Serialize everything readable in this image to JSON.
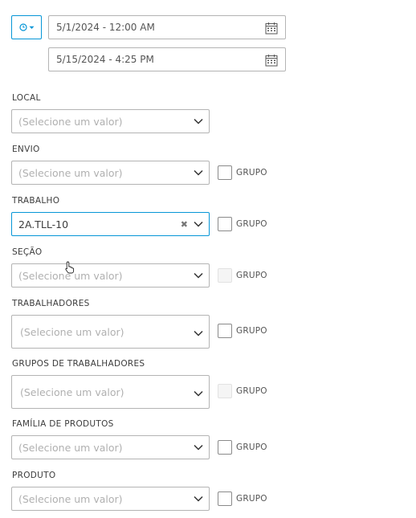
{
  "date_range": {
    "start": "5/1/2024 - 12:00 AM",
    "end": "5/15/2024 - 4:25 PM",
    "mode_icon": "clock-icon"
  },
  "filters": [
    {
      "label": "LOCAL",
      "value": "(Selecione um valor)"
    },
    {
      "label": "ENVIO",
      "value": "(Selecione um valor)",
      "group_label": "GRUPO"
    },
    {
      "label": "TRABALHO",
      "value": "2A.TLL-10",
      "group_label": "GRUPO"
    },
    {
      "label": "SEÇÃO",
      "value": "(Selecione um valor)",
      "group_label": "GRUPO"
    },
    {
      "label": "TRABALHADORES",
      "value": "(Selecione um valor)",
      "group_label": "GRUPO"
    },
    {
      "label": "GRUPOS DE TRABALHADORES",
      "value": "(Selecione um valor)",
      "group_label": "GRUPO"
    },
    {
      "label": "FAMÍLIA DE PRODUTOS",
      "value": "(Selecione um valor)",
      "group_label": "GRUPO"
    },
    {
      "label": "PRODUTO",
      "value": "(Selecione um valor)",
      "group_label": "GRUPO"
    }
  ],
  "colors": {
    "accent": "#0696d7",
    "border": "#b4b4b4",
    "placeholder": "#b0b0b0"
  }
}
